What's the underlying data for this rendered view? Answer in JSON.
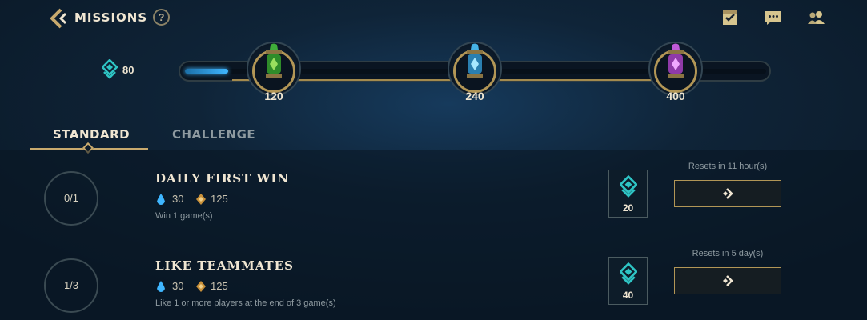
{
  "header": {
    "title": "MISSIONS",
    "help_label": "?",
    "icons": [
      "back-chevron-icon",
      "help-icon",
      "checklist-icon",
      "chat-icon",
      "friends-icon"
    ]
  },
  "progress": {
    "current_tokens": "80",
    "fill_fraction": 0.075,
    "milestones": [
      {
        "value": "120",
        "color": "#3fae3a"
      },
      {
        "value": "240",
        "color": "#46b3e6"
      },
      {
        "value": "400",
        "color": "#c05ad8"
      }
    ]
  },
  "tabs": [
    {
      "label": "STANDARD",
      "active": true
    },
    {
      "label": "CHALLENGE",
      "active": false
    }
  ],
  "missions": [
    {
      "progress": "0/1",
      "title": "DAILY FIRST WIN",
      "reward_blue": "30",
      "reward_orange": "125",
      "description": "Win 1 game(s)",
      "tokens": "20",
      "reset": "Resets in 11 hour(s)"
    },
    {
      "progress": "1/3",
      "title": "LIKE TEAMMATES",
      "reward_blue": "30",
      "reward_orange": "125",
      "description": "Like 1 or more players at the end of 3 game(s)",
      "tokens": "40",
      "reset": "Resets in 5 day(s)"
    }
  ],
  "colors": {
    "accent_gold": "#c8aa6e",
    "token_teal": "#2ec4c4",
    "blue_essence": "#3fb6ff",
    "orange_essence": "#c9913a"
  }
}
